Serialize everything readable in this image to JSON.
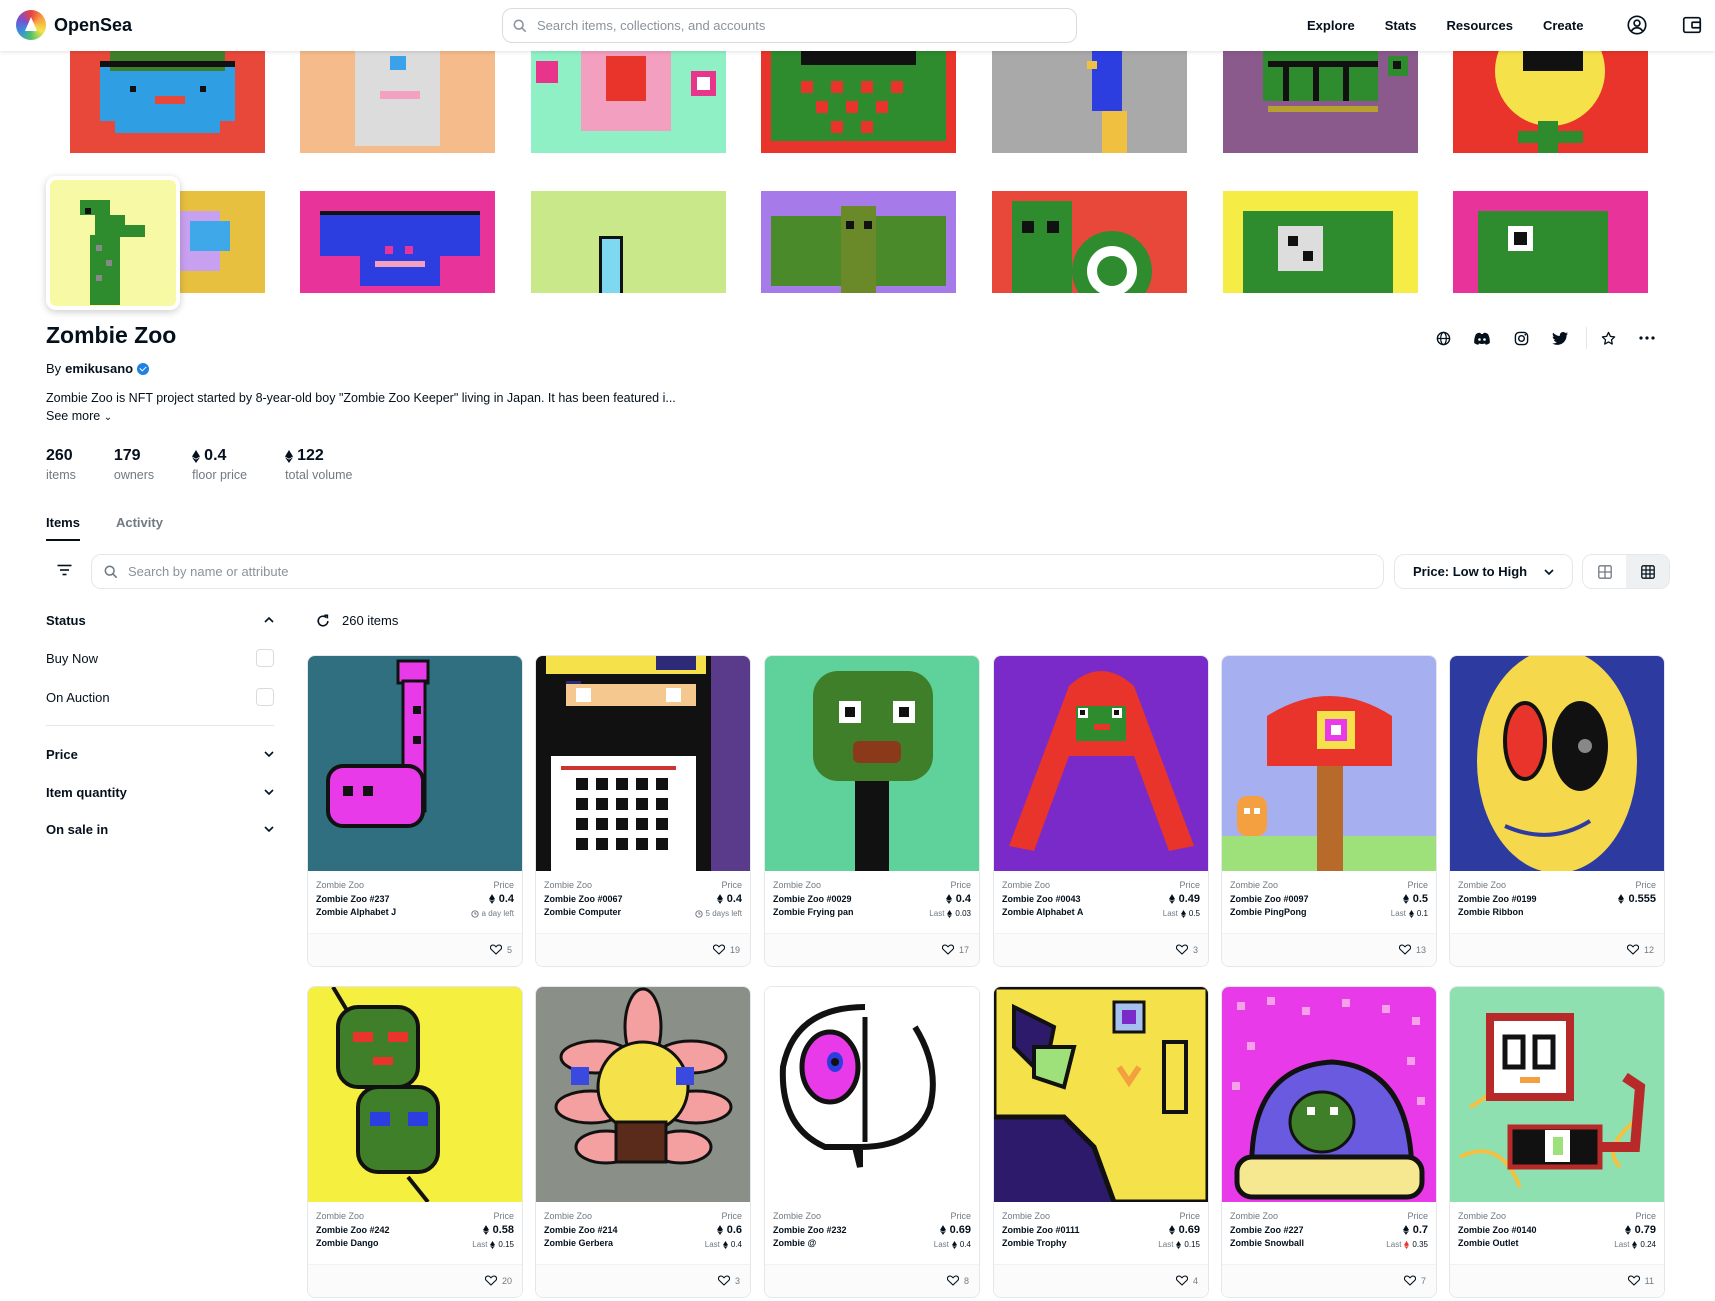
{
  "nav": {
    "logo_text": "OpenSea",
    "search_placeholder": "Search items, collections, and accounts",
    "links": [
      "Explore",
      "Stats",
      "Resources",
      "Create"
    ]
  },
  "collection": {
    "title": "Zombie Zoo",
    "by_label": "By",
    "creator": "emikusano",
    "description": "Zombie Zoo is NFT project started by 8-year-old boy \"Zombie Zoo Keeper\" living in Japan. It has been featured i...",
    "see_more": "See more",
    "stats": [
      {
        "value": "260",
        "label": "items",
        "eth": false
      },
      {
        "value": "179",
        "label": "owners",
        "eth": false
      },
      {
        "value": "0.4",
        "label": "floor price",
        "eth": true
      },
      {
        "value": "122",
        "label": "total volume",
        "eth": true
      }
    ]
  },
  "tabs": [
    "Items",
    "Activity"
  ],
  "filter": {
    "search_placeholder": "Search by name or attribute",
    "sort_label": "Price: Low to High"
  },
  "sidebar": {
    "status_label": "Status",
    "buy_now": "Buy Now",
    "on_auction": "On Auction",
    "price_label": "Price",
    "item_quantity_label": "Item quantity",
    "on_sale_in_label": "On sale in"
  },
  "results": {
    "count_text": "260 items"
  },
  "price_label": "Price",
  "last_label": "Last",
  "cards": [
    {
      "collection": "Zombie Zoo",
      "id": "Zombie Zoo #237",
      "name": "Zombie Alphabet J",
      "price": "0.4",
      "sub": "a day left",
      "sub_type": "time",
      "likes": "5"
    },
    {
      "collection": "Zombie Zoo",
      "id": "Zombie Zoo #0067",
      "name": "Zombie Computer",
      "price": "0.4",
      "sub": "5 days left",
      "sub_type": "time",
      "likes": "19"
    },
    {
      "collection": "Zombie Zoo",
      "id": "Zombie Zoo #0029",
      "name": "Zombie Frying pan",
      "price": "0.4",
      "sub": "0.03",
      "sub_type": "last",
      "likes": "17"
    },
    {
      "collection": "Zombie Zoo",
      "id": "Zombie Zoo #0043",
      "name": "Zombie Alphabet A",
      "price": "0.49",
      "sub": "0.5",
      "sub_type": "last",
      "likes": "3"
    },
    {
      "collection": "Zombie Zoo",
      "id": "Zombie Zoo #0097",
      "name": "Zombie PingPong",
      "price": "0.5",
      "sub": "0.1",
      "sub_type": "last",
      "likes": "13"
    },
    {
      "collection": "Zombie Zoo",
      "id": "Zombie Zoo #0199",
      "name": "Zombie Ribbon",
      "price": "0.555",
      "sub": "",
      "sub_type": "none",
      "likes": "12"
    },
    {
      "collection": "Zombie Zoo",
      "id": "Zombie Zoo #242",
      "name": "Zombie Dango",
      "price": "0.58",
      "sub": "0.15",
      "sub_type": "last",
      "likes": "20"
    },
    {
      "collection": "Zombie Zoo",
      "id": "Zombie Zoo #214",
      "name": "Zombie Gerbera",
      "price": "0.6",
      "sub": "0.4",
      "sub_type": "last",
      "likes": "3"
    },
    {
      "collection": "Zombie Zoo",
      "id": "Zombie Zoo #232",
      "name": "Zombie @",
      "price": "0.69",
      "sub": "0.4",
      "sub_type": "last",
      "likes": "8"
    },
    {
      "collection": "Zombie Zoo",
      "id": "Zombie Zoo #0111",
      "name": "Zombie Trophy",
      "price": "0.69",
      "sub": "0.15",
      "sub_type": "last",
      "likes": "4"
    },
    {
      "collection": "Zombie Zoo",
      "id": "Zombie Zoo #227",
      "name": "Zombie Snowball",
      "price": "0.7",
      "sub": "0.35",
      "sub_type": "last-red",
      "likes": "7"
    },
    {
      "collection": "Zombie Zoo",
      "id": "Zombie Zoo #0140",
      "name": "Zombie Outlet",
      "price": "0.79",
      "sub": "0.24",
      "sub_type": "last",
      "likes": "11"
    }
  ],
  "colors": {
    "accent_blue": "#2081e2",
    "text_primary": "#04111d",
    "text_secondary": "#707a83",
    "border": "#e5e8eb"
  }
}
